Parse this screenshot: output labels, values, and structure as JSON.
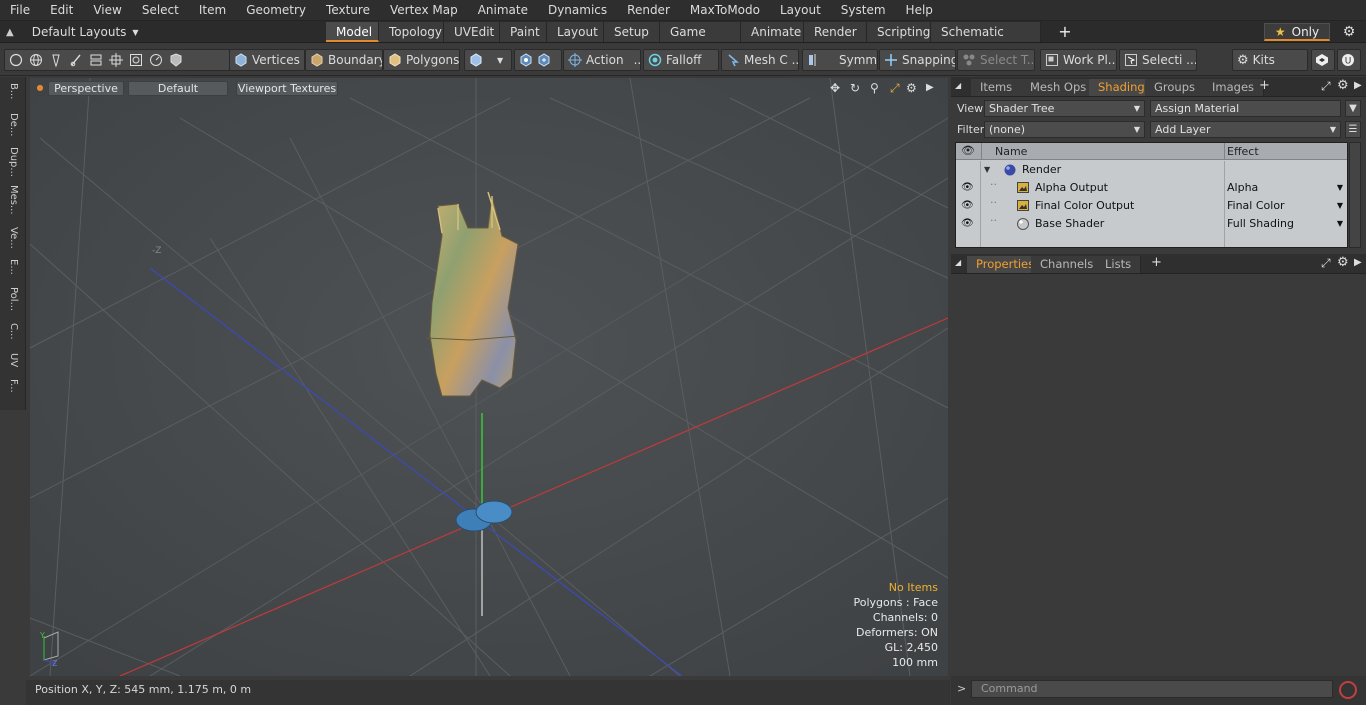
{
  "menubar": [
    "File",
    "Edit",
    "View",
    "Select",
    "Item",
    "Geometry",
    "Texture",
    "Vertex Map",
    "Animate",
    "Dynamics",
    "Render",
    "MaxToModo",
    "Layout",
    "System",
    "Help"
  ],
  "layouts": {
    "selector": "Default Layouts",
    "add": "+",
    "only": "Only",
    "only_icon": "star-icon",
    "tabs": [
      "Model",
      "Topology",
      "UVEdit",
      "Paint",
      "Layout",
      "Setup",
      "Game Tools",
      "Animate",
      "Render",
      "Scripting",
      "Schematic Fusion"
    ]
  },
  "toolbar": {
    "vertices": "Vertices",
    "boundary": "Boundary",
    "polygons": "Polygons",
    "action": "Action",
    "falloff": "Falloff",
    "meshc": "Mesh C ...",
    "symm": "Symm ...",
    "snapping": "Snapping",
    "selectt": "Select T...",
    "workpl": "Work Pl...",
    "selecti": "Selecti ...",
    "kits": "Kits",
    "ellipsis": "..."
  },
  "leftstrip": [
    "B...",
    "De...",
    "Dup...",
    "Mes...",
    "Ve...",
    "E...",
    "Pol...",
    "C...",
    "UV",
    "F..."
  ],
  "viewport": {
    "perspective": "Perspective",
    "shading": "Default",
    "textures": "Viewport Textures",
    "axis_z": "-Z",
    "info": {
      "selection": "No Items",
      "polygons": "Polygons : Face",
      "channels": "Channels: 0",
      "deformers": "Deformers: ON",
      "gl": "GL: 2,450",
      "scale": "100 mm"
    }
  },
  "status": {
    "position": "Position X, Y, Z:   545 mm, 1.175 m, 0 m"
  },
  "rpanel": {
    "tabs": [
      "Items",
      "Mesh Ops",
      "Shading",
      "Groups",
      "Images"
    ],
    "add": "+",
    "view_label": "View",
    "view_value": "Shader Tree",
    "assign": "Assign Material",
    "filter_label": "Filter",
    "filter_value": "(none)",
    "add_layer": "Add Layer",
    "col_name": "Name",
    "col_effect": "Effect",
    "rows": [
      {
        "name": "Render",
        "effect": ""
      },
      {
        "name": "Alpha Output",
        "effect": "Alpha"
      },
      {
        "name": "Final Color Output",
        "effect": "Final Color"
      },
      {
        "name": "Base Shader",
        "effect": "Full Shading"
      }
    ],
    "bottom_tabs": [
      "Properties",
      "Channels",
      "Lists"
    ],
    "command_placeholder": "Command"
  },
  "colors": {
    "accent": "#e08a2c",
    "selected_text": "#f0b030"
  }
}
